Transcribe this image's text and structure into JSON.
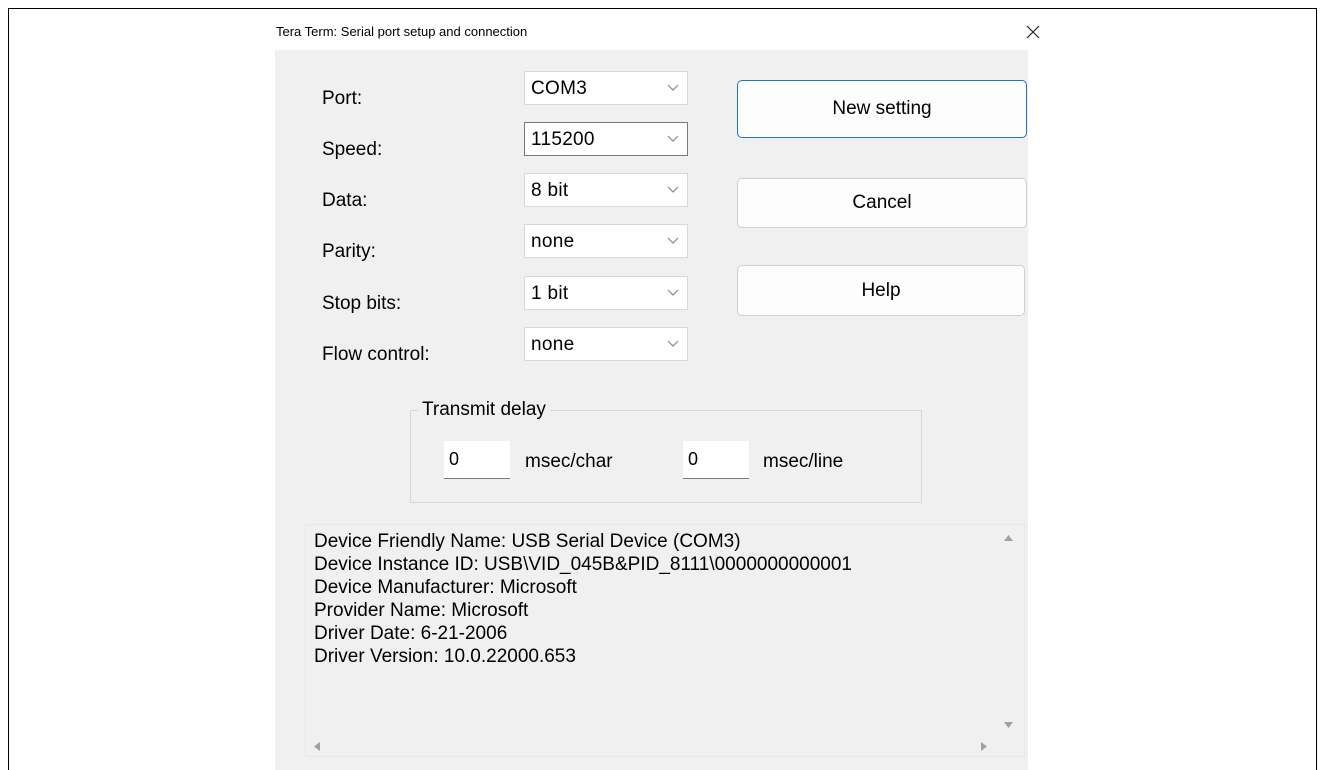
{
  "window": {
    "title": "Tera Term: Serial port setup and connection",
    "close_icon": "close-icon"
  },
  "settings": [
    {
      "label": "Port:",
      "value": "COM3"
    },
    {
      "label": "Speed:",
      "value": "115200"
    },
    {
      "label": "Data:",
      "value": "8 bit"
    },
    {
      "label": "Parity:",
      "value": "none"
    },
    {
      "label": "Stop bits:",
      "value": "1 bit"
    },
    {
      "label": "Flow control:",
      "value": "none"
    }
  ],
  "buttons": {
    "new_setting": "New setting",
    "cancel": "Cancel",
    "help": "Help"
  },
  "transmit_delay": {
    "title": "Transmit delay",
    "char_value": "0",
    "char_unit": "msec/char",
    "line_value": "0",
    "line_unit": "msec/line"
  },
  "device_info": [
    "Device Friendly Name: USB Serial Device (COM3)",
    "Device Instance ID: USB\\VID_045B&PID_8111\\0000000000001",
    "Device Manufacturer: Microsoft",
    "Provider Name: Microsoft",
    "Driver Date: 6-21-2006",
    "Driver Version: 10.0.22000.653"
  ],
  "colors": {
    "dialog_bg": "#f0f0f0",
    "primary_border": "#1f74c5"
  }
}
